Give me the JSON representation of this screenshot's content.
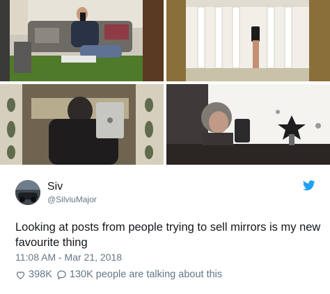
{
  "photos": [
    {
      "icon": "selfie-in-mirror-living-room"
    },
    {
      "icon": "phone-reflection-mirror-hallway"
    },
    {
      "icon": "tablet-reflection-ornate-mirror"
    },
    {
      "icon": "woman-phone-reflection-mirror"
    }
  ],
  "tweet": {
    "display_name": "Siv",
    "handle": "@SilviuMajor",
    "text": "Looking at posts from people trying to sell mirrors is my new favourite thing",
    "timestamp": "11:08 AM - Mar 21, 2018",
    "likes": "398K",
    "replies": "130K people are talking about this"
  },
  "colors": {
    "twitter_blue": "#1da1f2",
    "text_primary": "#14171a",
    "text_secondary": "#657786"
  }
}
